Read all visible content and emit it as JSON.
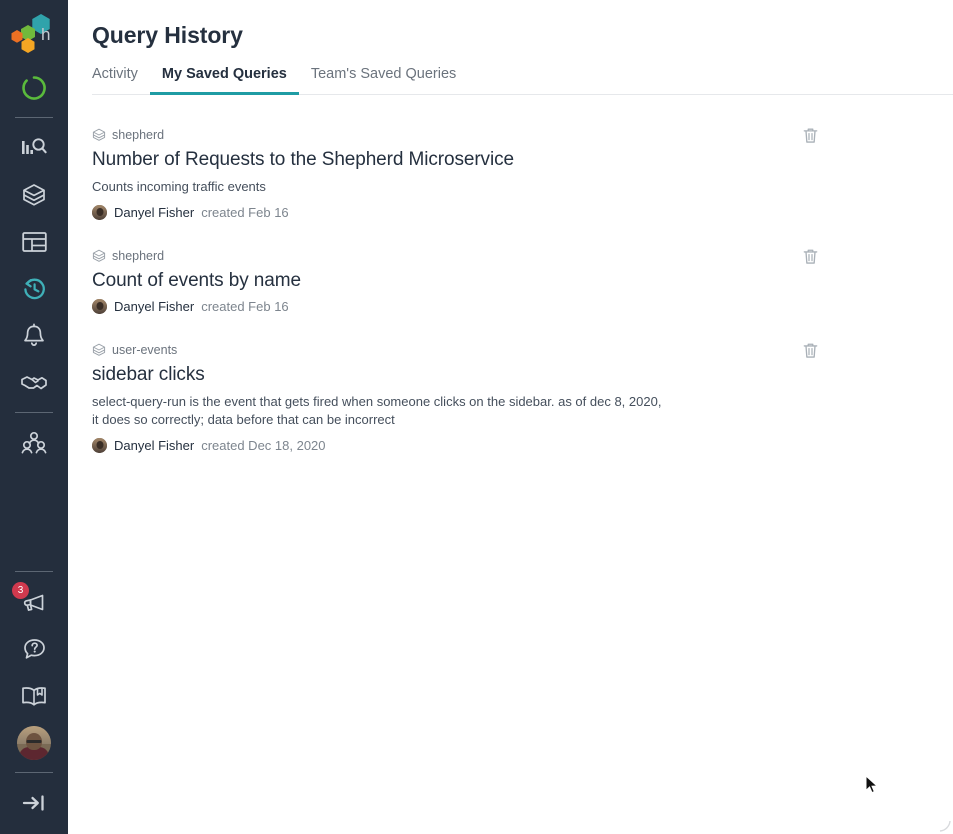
{
  "colors": {
    "sidebar_bg": "#242e3d",
    "accent_teal": "#1f9ca4",
    "active_icon_teal": "#3fb0b8",
    "badge_red": "#d0394e",
    "logo_teal": "#30a3ab",
    "logo_green": "#71b93c",
    "logo_orange": "#ec7023",
    "logo_yellow": "#f5a623",
    "text_primary": "#25303f",
    "text_muted": "#6b737d",
    "divider": "#e6e8eb"
  },
  "sidebar": {
    "logo": {
      "name": "honeycomb-logo",
      "letter": "h"
    },
    "items": [
      {
        "name": "loading-spinner-icon",
        "label": "Loading",
        "icon": "spinner",
        "active": false
      },
      {
        "name": "sidebar-item-query",
        "label": "Query",
        "icon": "query-bars",
        "active": false
      },
      {
        "name": "sidebar-item-datasets",
        "label": "Datasets",
        "icon": "cube",
        "active": false
      },
      {
        "name": "sidebar-item-boards",
        "label": "Boards",
        "icon": "board",
        "active": false
      },
      {
        "name": "sidebar-item-history",
        "label": "Query History",
        "icon": "history-clock",
        "active": true
      },
      {
        "name": "sidebar-item-triggers",
        "label": "Triggers",
        "icon": "bell",
        "active": false
      },
      {
        "name": "sidebar-item-slos",
        "label": "SLOs",
        "icon": "handshake",
        "active": false
      },
      {
        "name": "sidebar-item-team",
        "label": "Team",
        "icon": "people",
        "active": false
      }
    ],
    "bottom_items": [
      {
        "name": "sidebar-item-announcements",
        "label": "Announcements",
        "icon": "megaphone",
        "badge": "3"
      },
      {
        "name": "sidebar-item-help",
        "label": "Help",
        "icon": "question-bubble",
        "badge": null
      },
      {
        "name": "sidebar-item-docs",
        "label": "Documentation",
        "icon": "book",
        "badge": null
      },
      {
        "name": "sidebar-item-profile",
        "label": "Profile",
        "icon": "avatar",
        "badge": null
      },
      {
        "name": "sidebar-item-expand",
        "label": "Expand sidebar",
        "icon": "arrow-to-bar",
        "badge": null
      }
    ]
  },
  "header": {
    "title": "Query History"
  },
  "tabs": [
    {
      "label": "Activity",
      "active": false
    },
    {
      "label": "My Saved Queries",
      "active": true
    },
    {
      "label": "Team's Saved Queries",
      "active": false
    }
  ],
  "queries": [
    {
      "dataset": "shepherd",
      "title": "Number of Requests to the Shepherd Microservice",
      "description": "Counts incoming traffic events",
      "author": "Danyel Fisher",
      "created": "created Feb 16",
      "delete_label": "Delete"
    },
    {
      "dataset": "shepherd",
      "title": "Count of events by name",
      "description": "",
      "author": "Danyel Fisher",
      "created": "created Feb 16",
      "delete_label": "Delete"
    },
    {
      "dataset": "user-events",
      "title": "sidebar clicks",
      "description": "select-query-run is the event that gets fired when someone clicks on the sidebar. as of dec 8, 2020, it does so correctly; data before that can be incorrect",
      "author": "Danyel Fisher",
      "created": "created Dec 18, 2020",
      "delete_label": "Delete"
    }
  ]
}
